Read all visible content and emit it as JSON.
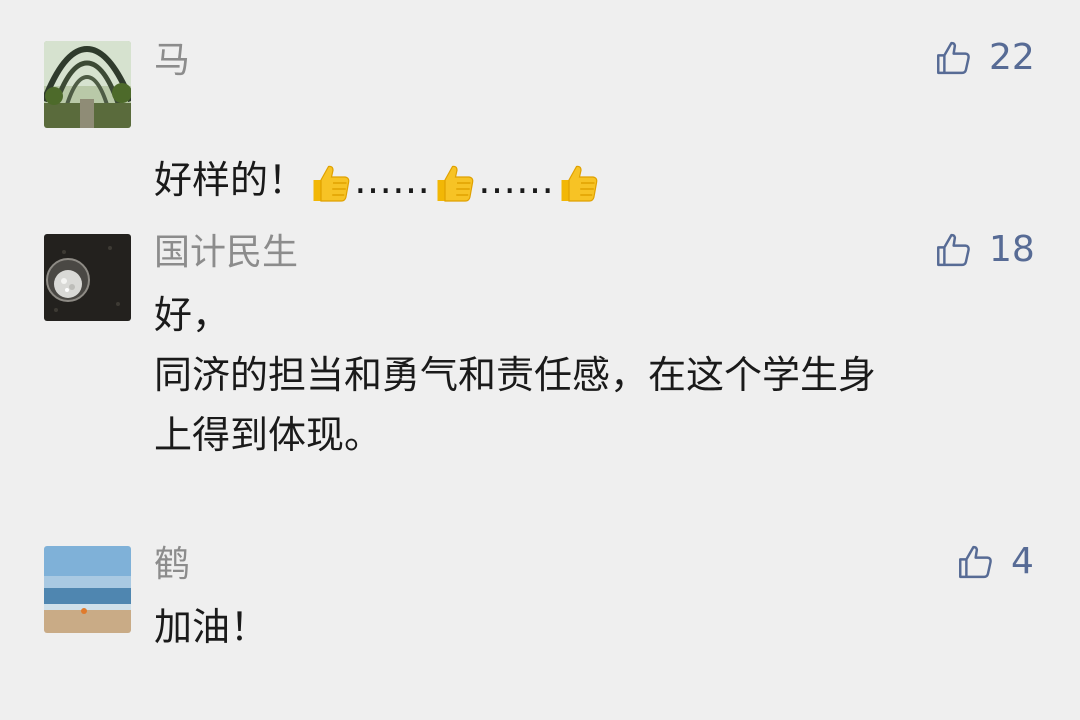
{
  "comments": [
    {
      "name": "马",
      "likes": "22",
      "text_parts": [
        "好样的！",
        "……",
        "……"
      ],
      "like_icon": "thumbs-up-outline-icon",
      "emoji_icon": "thumbs-up-emoji-icon"
    },
    {
      "name": "国计民生",
      "likes": "18",
      "text": "好，\n同济的担当和勇气和责任感，在这个学生身\n上得到体现。",
      "like_icon": "thumbs-up-outline-icon"
    },
    {
      "name": "鹤",
      "likes": "4",
      "text": "加油！",
      "like_icon": "thumbs-up-outline-icon"
    }
  ],
  "colors": {
    "background": "#efefef",
    "name": "#8c8c8c",
    "like": "#576b95",
    "text": "#1a1a1a",
    "emoji": "#f7c325"
  }
}
